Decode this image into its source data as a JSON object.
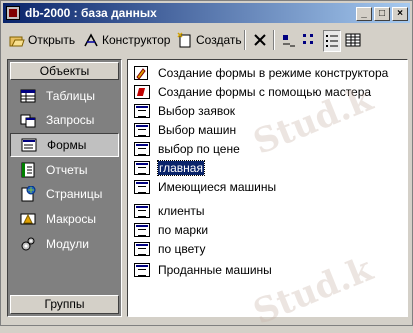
{
  "window": {
    "title": "db-2000 : база данных",
    "controls": [
      "_",
      "□",
      "×"
    ]
  },
  "toolbar": {
    "open_label": "Открыть",
    "design_label": "Конструктор",
    "create_label": "Создать"
  },
  "left_panel": {
    "header": "Объекты",
    "footer": "Группы",
    "items": [
      {
        "label": "Таблицы",
        "icon": "table-icon"
      },
      {
        "label": "Запросы",
        "icon": "query-icon"
      },
      {
        "label": "Формы",
        "icon": "form-icon",
        "selected": true
      },
      {
        "label": "Отчеты",
        "icon": "report-icon"
      },
      {
        "label": "Страницы",
        "icon": "page-icon"
      },
      {
        "label": "Макросы",
        "icon": "macro-icon"
      },
      {
        "label": "Модули",
        "icon": "module-icon"
      }
    ]
  },
  "list": {
    "items": [
      {
        "label": "Создание формы в режиме конструктора",
        "icon": "design-form-icon"
      },
      {
        "label": "Создание формы с помощью мастера",
        "icon": "wizard-icon"
      },
      {
        "label": "Выбор заявок",
        "icon": "form-icon"
      },
      {
        "label": "Выбор машин",
        "icon": "form-icon"
      },
      {
        "label": "выбор по цене",
        "icon": "form-icon"
      },
      {
        "label": "главная",
        "icon": "form-icon",
        "selected": true
      },
      {
        "label": "Имеющиеся машины",
        "icon": "form-icon"
      },
      {
        "label": "клиенты",
        "icon": "form-icon"
      },
      {
        "label": "по марки",
        "icon": "form-icon"
      },
      {
        "label": "по цвету",
        "icon": "form-icon"
      },
      {
        "label": "Проданные машины",
        "icon": "form-icon"
      }
    ]
  },
  "watermark": "Stud.k"
}
